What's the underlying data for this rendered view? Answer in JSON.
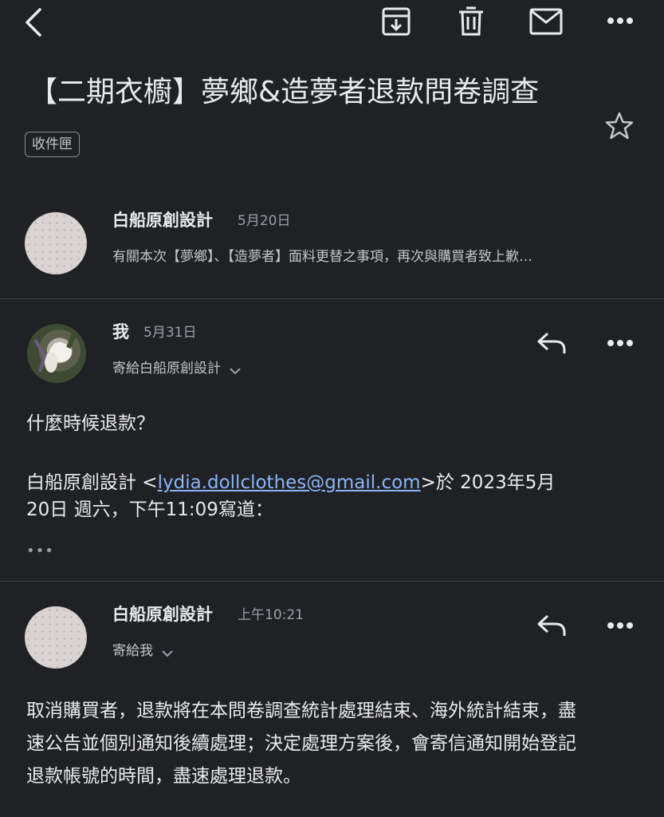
{
  "title": "【二期衣櫥】夢鄉&造夢者退款問卷調查",
  "label": "收件匣",
  "messages": [
    {
      "sender": "白船原創設計",
      "date": "5月20日",
      "snippet": "有關本次【夢鄉】、【造夢者】面料更替之事項，再次與購買者致上歉…"
    },
    {
      "sender": "我",
      "date": "5月31日",
      "to": "寄給白船原創設計",
      "body": "什麼時候退款？",
      "quote_prefix": "白船原創設計 <",
      "quote_email": "lydia.dollclothes@gmail.com",
      "quote_suffix": ">於 2023年5月",
      "quote_line2": "20日 週六，下午11:09寫道：",
      "more": "•••"
    },
    {
      "sender": "白船原創設計",
      "date": "上午10:21",
      "to": "寄給我",
      "body_lines": [
        "取消購買者，退款將在本問卷調查統計處理結束、海外統計結束，盡",
        "速公告並個別通知後續處理；決定處理方案後，會寄信通知開始登記",
        "退款帳號的時間，盡速處理退款。"
      ]
    }
  ],
  "icons": {
    "back": "back-icon",
    "archive": "archive-icon",
    "delete": "delete-icon",
    "mark_unread": "mail-icon",
    "more": "more-icon",
    "star": "star-icon",
    "reply": "reply-icon",
    "chevron": "chevron-down-icon"
  },
  "colors": {
    "background": "#202124",
    "text": "#e8eaed",
    "muted": "#9aa0a6",
    "link": "#8ab4f8"
  }
}
